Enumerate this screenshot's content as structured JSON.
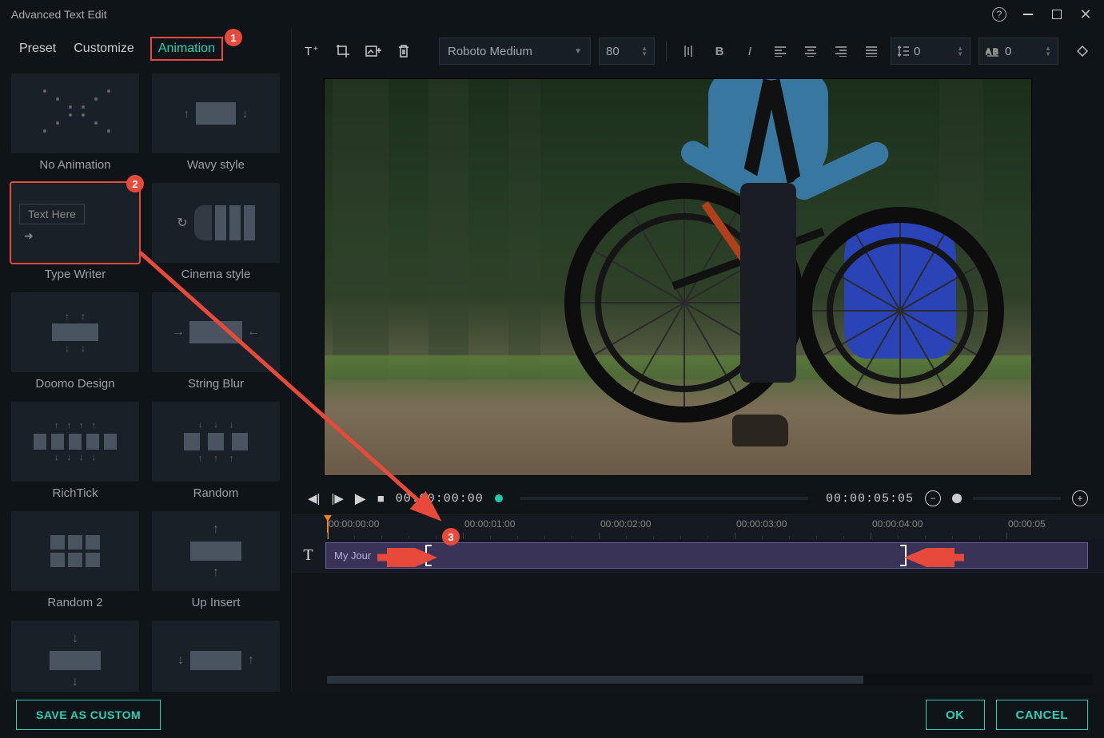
{
  "window": {
    "title": "Advanced Text Edit"
  },
  "tabs": {
    "preset": "Preset",
    "customize": "Customize",
    "animation": "Animation"
  },
  "annotations": {
    "badge1": "1",
    "badge2": "2",
    "badge3": "3"
  },
  "animations": [
    {
      "label": "No Animation",
      "art": "x"
    },
    {
      "label": "Wavy style",
      "art": "wavy"
    },
    {
      "label": "Type Writer",
      "art": "type",
      "text": "Text Here",
      "selected": true
    },
    {
      "label": "Cinema style",
      "art": "cinema"
    },
    {
      "label": "Doomo Design",
      "art": "doomo"
    },
    {
      "label": "String Blur",
      "art": "string"
    },
    {
      "label": "RichTick",
      "art": "rich"
    },
    {
      "label": "Random",
      "art": "rand"
    },
    {
      "label": "Random 2",
      "art": "rand2"
    },
    {
      "label": "Up Insert",
      "art": "up"
    },
    {
      "label": "",
      "art": "down1"
    },
    {
      "label": "",
      "art": "down2"
    }
  ],
  "toolbar": {
    "font": "Roboto Medium",
    "size": "80",
    "line_spacing": "0",
    "char_spacing": "0"
  },
  "player": {
    "current": "00:00:00:00",
    "duration": "00:00:05:05"
  },
  "ruler": {
    "labels": [
      "00:00:00:00",
      "00:00:01:00",
      "00:00:02:00",
      "00:00:03:00",
      "00:00:04:00",
      "00:00:05"
    ]
  },
  "track": {
    "icon": "T",
    "clip_label": "My Jour"
  },
  "footer": {
    "save": "SAVE AS CUSTOM",
    "ok": "OK",
    "cancel": "CANCEL"
  }
}
